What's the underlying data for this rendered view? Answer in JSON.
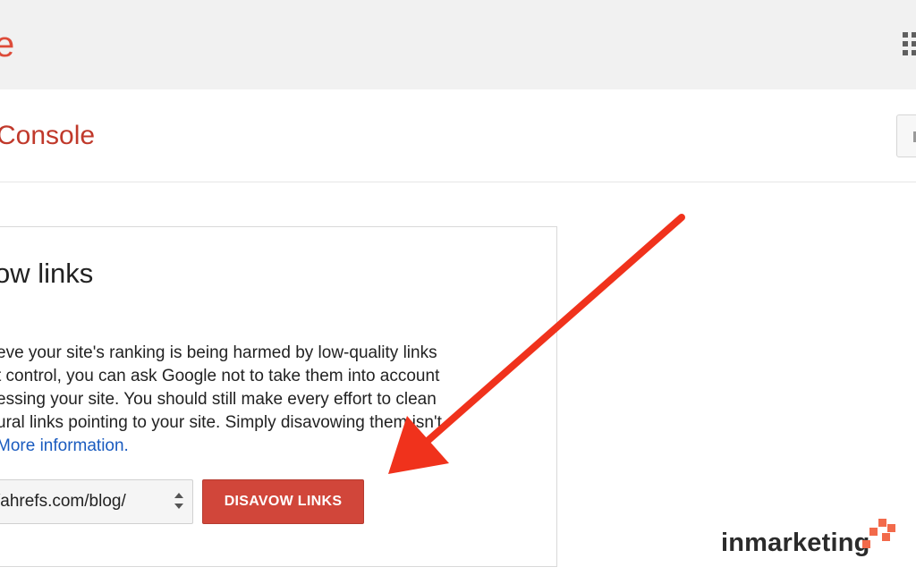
{
  "topbar": {
    "logo_fragment": "e",
    "apps_icon": "apps-grid-icon"
  },
  "subheader": {
    "title": "Console",
    "header_button_icon": "more-icon"
  },
  "card": {
    "title": "ow links",
    "body_lines": [
      "eve your site's ranking is being harmed by low-quality links",
      "t control, you can ask Google not to take them into account",
      "essing your site. You should still make every effort to clean",
      "ural links pointing to your site. Simply disavowing them isn't"
    ],
    "more_link": "More information.",
    "site_select_value": "/ahrefs.com/blog/",
    "disavow_button": "DISAVOW LINKS"
  },
  "overlay": {
    "arrow_color": "#f0321c",
    "arrow_icon": "arrow-annotation-icon"
  },
  "watermark": {
    "brand": "inmarketing",
    "brand_color": "#2b2b2b",
    "mark_color": "#f26a4b"
  }
}
